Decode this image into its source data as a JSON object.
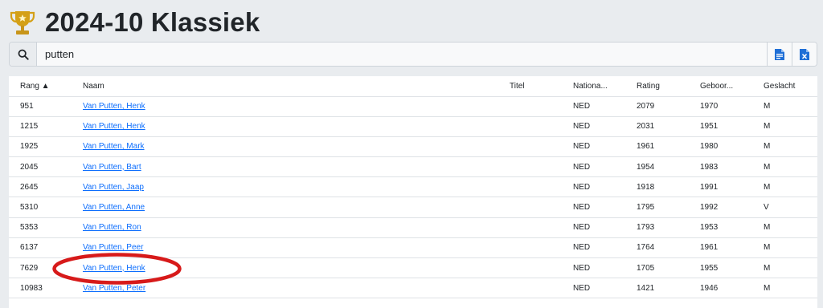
{
  "page": {
    "title": "2024-10 Klassiek"
  },
  "search": {
    "value": "putten",
    "placeholder": ""
  },
  "icons": {
    "trophy": "trophy-icon",
    "search": "search-icon",
    "export_csv": "csv-file-icon",
    "export_excel": "excel-file-icon"
  },
  "colors": {
    "link": "#0d6efd",
    "trophy": "#d4a017",
    "annotation": "#d71a1a"
  },
  "table": {
    "headers": {
      "rang": "Rang ▲",
      "naam": "Naam",
      "titel": "Titel",
      "nationaliteit": "Nationa...",
      "rating": "Rating",
      "geboortejaar": "Geboor...",
      "geslacht": "Geslacht"
    },
    "rows": [
      {
        "rang": "951",
        "naam": "Van Putten, Henk",
        "titel": "",
        "nationaliteit": "NED",
        "rating": "2079",
        "geboortejaar": "1970",
        "geslacht": "M"
      },
      {
        "rang": "1215",
        "naam": "Van Putten, Henk",
        "titel": "",
        "nationaliteit": "NED",
        "rating": "2031",
        "geboortejaar": "1951",
        "geslacht": "M"
      },
      {
        "rang": "1925",
        "naam": "Van Putten, Mark",
        "titel": "",
        "nationaliteit": "NED",
        "rating": "1961",
        "geboortejaar": "1980",
        "geslacht": "M"
      },
      {
        "rang": "2045",
        "naam": "Van Putten, Bart",
        "titel": "",
        "nationaliteit": "NED",
        "rating": "1954",
        "geboortejaar": "1983",
        "geslacht": "M"
      },
      {
        "rang": "2645",
        "naam": "Van Putten, Jaap",
        "titel": "",
        "nationaliteit": "NED",
        "rating": "1918",
        "geboortejaar": "1991",
        "geslacht": "M"
      },
      {
        "rang": "5310",
        "naam": "Van Putten, Anne",
        "titel": "",
        "nationaliteit": "NED",
        "rating": "1795",
        "geboortejaar": "1992",
        "geslacht": "V"
      },
      {
        "rang": "5353",
        "naam": "Van Putten, Ron",
        "titel": "",
        "nationaliteit": "NED",
        "rating": "1793",
        "geboortejaar": "1953",
        "geslacht": "M"
      },
      {
        "rang": "6137",
        "naam": "Van Putten, Peer",
        "titel": "",
        "nationaliteit": "NED",
        "rating": "1764",
        "geboortejaar": "1961",
        "geslacht": "M"
      },
      {
        "rang": "7629",
        "naam": "Van Putten, Henk",
        "titel": "",
        "nationaliteit": "NED",
        "rating": "1705",
        "geboortejaar": "1955",
        "geslacht": "M"
      },
      {
        "rang": "10983",
        "naam": "Van Putten, Peter",
        "titel": "",
        "nationaliteit": "NED",
        "rating": "1421",
        "geboortejaar": "1946",
        "geslacht": "M"
      }
    ]
  }
}
